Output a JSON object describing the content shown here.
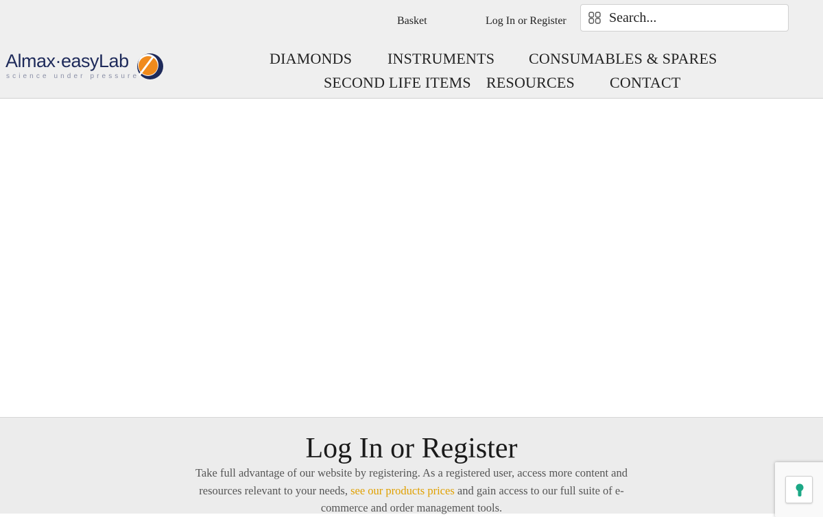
{
  "header": {
    "basket_label": "Basket",
    "login_label": "Log In or Register",
    "search": {
      "placeholder": "Search...",
      "icon": "grid-search-icon"
    }
  },
  "logo": {
    "name": "Almax·easyLab",
    "tagline": "science under pressure",
    "colors": {
      "text": "#1e2a5a",
      "accent": "#f08a1c"
    }
  },
  "nav": {
    "items": [
      {
        "label": "DIAMONDS"
      },
      {
        "label": "INSTRUMENTS"
      },
      {
        "label": "CONSUMABLES & SPARES"
      },
      {
        "label": "SECOND LIFE ITEMS"
      },
      {
        "label": "RESOURCES"
      },
      {
        "label": "CONTACT"
      }
    ]
  },
  "login_section": {
    "title": "Log In or Register",
    "desc_before": "Take full advantage of our website by registering. As a registered user, access more content and resources relevant to your needs, ",
    "desc_link": "see our products prices",
    "desc_after": " and gain access to our full suite of e-commerce and order management tools.",
    "link_color": "#e0a000"
  },
  "recaptcha": {
    "icon": "recaptcha-keyhole-icon"
  }
}
